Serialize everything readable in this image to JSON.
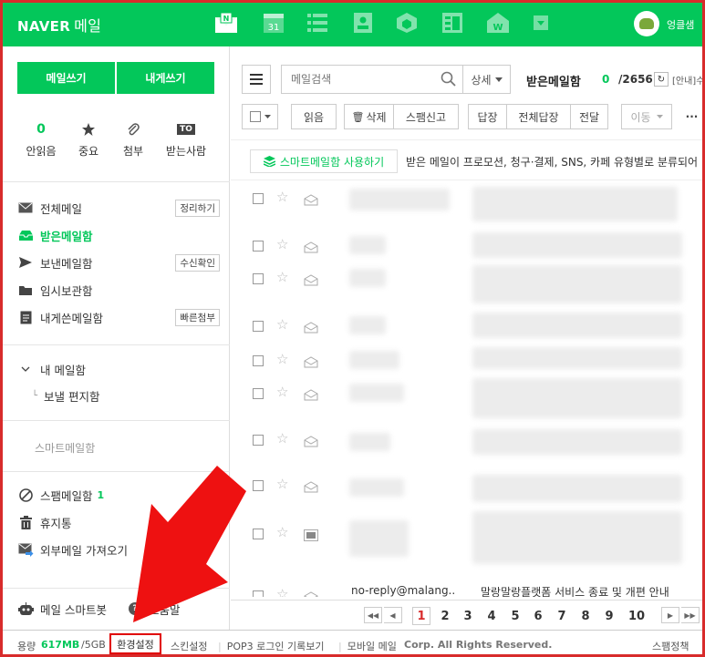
{
  "app": {
    "brand": "NAVER",
    "service": "메일"
  },
  "user": {
    "name": "엉클샘"
  },
  "colors": {
    "accent": "#03c75a",
    "highlight_red": "#d82b2b",
    "arrow_red": "#ee1111"
  },
  "topnav": {
    "icons": [
      "mail-app-icon",
      "calendar-app-icon",
      "contacts-app-icon",
      "address-book-icon",
      "cube-app-icon",
      "memo-app-icon",
      "works-app-icon",
      "more-apps-icon"
    ],
    "calendar_day": "31",
    "mail_badge": "N",
    "works_badge": "W"
  },
  "compose": {
    "write_mail": "메일쓰기",
    "write_to_me": "내게쓰기"
  },
  "quick": [
    {
      "top": "0",
      "label": "안읽음",
      "icon": "unread-count"
    },
    {
      "top": "",
      "label": "중요",
      "icon": "star-icon"
    },
    {
      "top": "",
      "label": "첨부",
      "icon": "paperclip-icon"
    },
    {
      "top": "TO",
      "label": "받는사람",
      "icon": "to-badge-icon"
    }
  ],
  "mailboxes": [
    {
      "label": "전체메일",
      "tag": "정리하기",
      "icon": "all-mail-icon"
    },
    {
      "label": "받은메일함",
      "tag": "",
      "icon": "inbox-icon"
    },
    {
      "label": "보낸메일함",
      "tag": "수신확인",
      "icon": "sent-icon"
    },
    {
      "label": "임시보관함",
      "tag": "",
      "icon": "folder-icon"
    },
    {
      "label": "내게쓴메일함",
      "tag": "빠른첨부",
      "icon": "note-icon"
    }
  ],
  "my_mailbox": {
    "label": "내 메일함",
    "sub": "보낼 편지함"
  },
  "smart_mailbox": "스마트메일함",
  "extra_boxes": {
    "spam": "스팸메일함",
    "spam_count": "1",
    "trash": "휴지통",
    "import": "외부메일 가져오기"
  },
  "sidebar_footer": {
    "smartbot": "메일 스마트봇",
    "help": "도움말",
    "help_icon": "?"
  },
  "toolbar": {
    "search_placeholder": "메일검색",
    "detail": "상세",
    "folder_title": "받은메일함",
    "unread": "0",
    "total": "/2656",
    "retro": "[안내]수신",
    "actions": [
      "읽음",
      "삭제",
      "스팸신고",
      "답장",
      "전체답장",
      "전달",
      "이동",
      "···"
    ]
  },
  "smart_banner": {
    "button": "스마트메일함 사용하기",
    "desc": "받은 메일이 프로모션, 청구·결제, SNS, 카페 유형별로 분류되어"
  },
  "last_mail": {
    "from": "no-reply@malang...",
    "subject": "말랑말랑플랫폼 서비스 종료 및 개편 안내"
  },
  "pagination": {
    "pages": [
      "1",
      "2",
      "3",
      "4",
      "5",
      "6",
      "7",
      "8",
      "9",
      "10"
    ],
    "current": "1"
  },
  "status": {
    "quota_label": "용량",
    "quota_used": "617MB",
    "quota_total": "/5GB",
    "settings": "환경설정",
    "skin": "스킨설정",
    "pop3": "POP3 로그인 기록보기",
    "mobile": "모바일 메일",
    "copyright": "Corp. All Rights Reserved.",
    "spam_policy": "스팸정책"
  }
}
